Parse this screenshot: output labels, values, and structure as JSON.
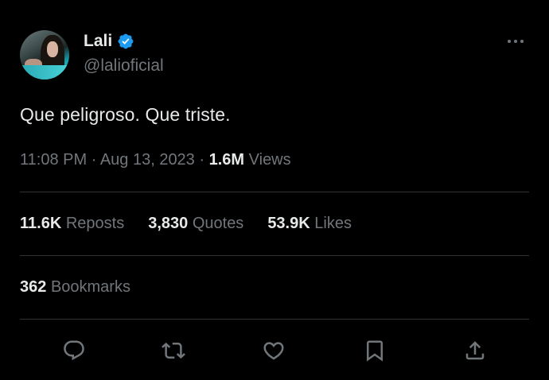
{
  "author": {
    "display_name": "Lali",
    "handle": "@lalioficial",
    "verified": true
  },
  "tweet": {
    "text": "Que peligroso. Que triste.",
    "time": "11:08 PM",
    "date": "Aug 13, 2023",
    "views_count": "1.6M",
    "views_label": "Views"
  },
  "stats": {
    "reposts_count": "11.6K",
    "reposts_label": "Reposts",
    "quotes_count": "3,830",
    "quotes_label": "Quotes",
    "likes_count": "53.9K",
    "likes_label": "Likes",
    "bookmarks_count": "362",
    "bookmarks_label": "Bookmarks"
  },
  "actions": [
    "reply-icon",
    "repost-icon",
    "like-icon",
    "bookmark-icon",
    "share-icon"
  ],
  "colors": {
    "background": "#000000",
    "text_primary": "#e7e9ea",
    "text_secondary": "#71767b",
    "divider": "#2f3336",
    "verified_badge": "#1d9bf0"
  }
}
